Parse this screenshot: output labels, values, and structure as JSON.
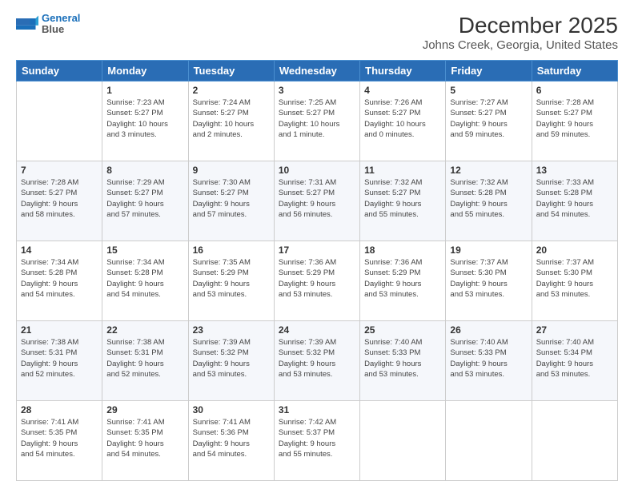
{
  "header": {
    "logo_line1": "General",
    "logo_line2": "Blue",
    "title": "December 2025",
    "subtitle": "Johns Creek, Georgia, United States"
  },
  "days_of_week": [
    "Sunday",
    "Monday",
    "Tuesday",
    "Wednesday",
    "Thursday",
    "Friday",
    "Saturday"
  ],
  "weeks": [
    [
      {
        "num": "",
        "info": ""
      },
      {
        "num": "1",
        "info": "Sunrise: 7:23 AM\nSunset: 5:27 PM\nDaylight: 10 hours\nand 3 minutes."
      },
      {
        "num": "2",
        "info": "Sunrise: 7:24 AM\nSunset: 5:27 PM\nDaylight: 10 hours\nand 2 minutes."
      },
      {
        "num": "3",
        "info": "Sunrise: 7:25 AM\nSunset: 5:27 PM\nDaylight: 10 hours\nand 1 minute."
      },
      {
        "num": "4",
        "info": "Sunrise: 7:26 AM\nSunset: 5:27 PM\nDaylight: 10 hours\nand 0 minutes."
      },
      {
        "num": "5",
        "info": "Sunrise: 7:27 AM\nSunset: 5:27 PM\nDaylight: 9 hours\nand 59 minutes."
      },
      {
        "num": "6",
        "info": "Sunrise: 7:28 AM\nSunset: 5:27 PM\nDaylight: 9 hours\nand 59 minutes."
      }
    ],
    [
      {
        "num": "7",
        "info": "Sunrise: 7:28 AM\nSunset: 5:27 PM\nDaylight: 9 hours\nand 58 minutes."
      },
      {
        "num": "8",
        "info": "Sunrise: 7:29 AM\nSunset: 5:27 PM\nDaylight: 9 hours\nand 57 minutes."
      },
      {
        "num": "9",
        "info": "Sunrise: 7:30 AM\nSunset: 5:27 PM\nDaylight: 9 hours\nand 57 minutes."
      },
      {
        "num": "10",
        "info": "Sunrise: 7:31 AM\nSunset: 5:27 PM\nDaylight: 9 hours\nand 56 minutes."
      },
      {
        "num": "11",
        "info": "Sunrise: 7:32 AM\nSunset: 5:27 PM\nDaylight: 9 hours\nand 55 minutes."
      },
      {
        "num": "12",
        "info": "Sunrise: 7:32 AM\nSunset: 5:28 PM\nDaylight: 9 hours\nand 55 minutes."
      },
      {
        "num": "13",
        "info": "Sunrise: 7:33 AM\nSunset: 5:28 PM\nDaylight: 9 hours\nand 54 minutes."
      }
    ],
    [
      {
        "num": "14",
        "info": "Sunrise: 7:34 AM\nSunset: 5:28 PM\nDaylight: 9 hours\nand 54 minutes."
      },
      {
        "num": "15",
        "info": "Sunrise: 7:34 AM\nSunset: 5:28 PM\nDaylight: 9 hours\nand 54 minutes."
      },
      {
        "num": "16",
        "info": "Sunrise: 7:35 AM\nSunset: 5:29 PM\nDaylight: 9 hours\nand 53 minutes."
      },
      {
        "num": "17",
        "info": "Sunrise: 7:36 AM\nSunset: 5:29 PM\nDaylight: 9 hours\nand 53 minutes."
      },
      {
        "num": "18",
        "info": "Sunrise: 7:36 AM\nSunset: 5:29 PM\nDaylight: 9 hours\nand 53 minutes."
      },
      {
        "num": "19",
        "info": "Sunrise: 7:37 AM\nSunset: 5:30 PM\nDaylight: 9 hours\nand 53 minutes."
      },
      {
        "num": "20",
        "info": "Sunrise: 7:37 AM\nSunset: 5:30 PM\nDaylight: 9 hours\nand 53 minutes."
      }
    ],
    [
      {
        "num": "21",
        "info": "Sunrise: 7:38 AM\nSunset: 5:31 PM\nDaylight: 9 hours\nand 52 minutes."
      },
      {
        "num": "22",
        "info": "Sunrise: 7:38 AM\nSunset: 5:31 PM\nDaylight: 9 hours\nand 52 minutes."
      },
      {
        "num": "23",
        "info": "Sunrise: 7:39 AM\nSunset: 5:32 PM\nDaylight: 9 hours\nand 53 minutes."
      },
      {
        "num": "24",
        "info": "Sunrise: 7:39 AM\nSunset: 5:32 PM\nDaylight: 9 hours\nand 53 minutes."
      },
      {
        "num": "25",
        "info": "Sunrise: 7:40 AM\nSunset: 5:33 PM\nDaylight: 9 hours\nand 53 minutes."
      },
      {
        "num": "26",
        "info": "Sunrise: 7:40 AM\nSunset: 5:33 PM\nDaylight: 9 hours\nand 53 minutes."
      },
      {
        "num": "27",
        "info": "Sunrise: 7:40 AM\nSunset: 5:34 PM\nDaylight: 9 hours\nand 53 minutes."
      }
    ],
    [
      {
        "num": "28",
        "info": "Sunrise: 7:41 AM\nSunset: 5:35 PM\nDaylight: 9 hours\nand 54 minutes."
      },
      {
        "num": "29",
        "info": "Sunrise: 7:41 AM\nSunset: 5:35 PM\nDaylight: 9 hours\nand 54 minutes."
      },
      {
        "num": "30",
        "info": "Sunrise: 7:41 AM\nSunset: 5:36 PM\nDaylight: 9 hours\nand 54 minutes."
      },
      {
        "num": "31",
        "info": "Sunrise: 7:42 AM\nSunset: 5:37 PM\nDaylight: 9 hours\nand 55 minutes."
      },
      {
        "num": "",
        "info": ""
      },
      {
        "num": "",
        "info": ""
      },
      {
        "num": "",
        "info": ""
      }
    ]
  ]
}
